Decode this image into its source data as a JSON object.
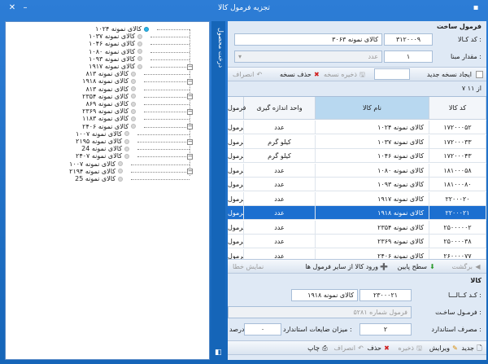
{
  "window": {
    "title": "تجزیه فرمول کالا"
  },
  "tree": {
    "root_label": "درخت محصول",
    "nodes": [
      {
        "label": "کالای نمونه ۱۰۲۴",
        "selected": true
      },
      {
        "label": "کالای نمونه ۱۰۳۷"
      },
      {
        "label": "کالای نمونه ۱۰۴۶"
      },
      {
        "label": "کالای نمونه ۱۰۸۰"
      },
      {
        "label": "کالای نمونه ۱۰۹۳"
      },
      {
        "label": "کالای نمونه ۱۹۱۷"
      },
      {
        "label": "کالای نمونه ۸۱۳"
      },
      {
        "label": "کالای نمونه ۱۹۱۸"
      },
      {
        "label": "کالای نمونه ۸۱۳"
      },
      {
        "label": "کالای نمونه ۲۳۵۴"
      },
      {
        "label": "کالای نمونه ۸۶۹"
      },
      {
        "label": "کالای نمونه ۲۳۶۹"
      },
      {
        "label": "کالای نمونه ۱۱۸۳"
      },
      {
        "label": "کالای نمونه ۲۴۰۶"
      },
      {
        "label": "کالای نمونه ۱۰۰۷"
      },
      {
        "label": "کالای نمونه ۲۱۹۵"
      },
      {
        "label": "کالای نمونه 24"
      },
      {
        "label": "کالای نمونه ۲۴۰۷"
      },
      {
        "label": "کالای نمونه ۱۰۰۷"
      },
      {
        "label": "کالای نمونه ۲۱۹۴"
      },
      {
        "label": "کالای نمونه 25"
      }
    ]
  },
  "formula": {
    "section_title": "فرمول ساخت",
    "code_label": "کد کـالا :",
    "code_value": "۳۱۲۰۰۰۹",
    "name_value": "کالای نمونه ۳۰۶۳",
    "qty_label": "مقدار مبنا :",
    "qty_value": "۱",
    "unit_value": "عدد",
    "new_copy_label": "ایجاد نسخه جدید",
    "save_copy": "ذخیره نسخه",
    "delete_copy": "حذف نسخه",
    "cancel": "انصراف",
    "record_count": "از ۱۱ ۷"
  },
  "grid": {
    "headers": [
      "کد کالا",
      "نام کالا",
      "واحد اندازه گیری",
      "فرمول"
    ],
    "rows": [
      [
        "۱۷۲۰۰۰۵۲",
        "کالای نمونه ۱۰۲۴",
        "عدد",
        "فرمول"
      ],
      [
        "۱۷۲۰۰۰۳۳",
        "کالای نمونه ۱۰۳۷",
        "کیلو گرم",
        "فرمول"
      ],
      [
        "۱۷۲۰۰۰۴۳",
        "کالای نمونه ۱۰۴۶",
        "کیلو گرم",
        "فرمول"
      ],
      [
        "۱۸۱۰۰۰۵۸",
        "کالای نمونه ۱۰۸۰",
        "عدد",
        "فرمول"
      ],
      [
        "۱۸۱۰۰۰۸۰",
        "کالای نمونه ۱۰۹۳",
        "عدد",
        "فرمول"
      ],
      [
        "۲۲۰۰۰۲۰",
        "کالای نمونه ۱۹۱۷",
        "عدد",
        "فرمول"
      ],
      [
        "۲۲۰۰۰۲۱",
        "کالای نمونه ۱۹۱۸",
        "عدد",
        "فرمول"
      ],
      [
        "۲۵۰۰۰۰۰۲",
        "کالای نمونه ۲۳۵۴",
        "عدد",
        "فرمول"
      ],
      [
        "۲۵۰۰۰۰۳۸",
        "کالای نمونه ۲۳۶۹",
        "عدد",
        "فرمول"
      ],
      [
        "۲۶۰۰۰۰۷۷",
        "کالای نمونه ۲۴۰۶",
        "عدد",
        "فرمول"
      ]
    ],
    "selected_row": 6
  },
  "nav_bar": {
    "back": "برگشت",
    "level_down": "سطح پایین",
    "import": "ورود کالا از سایر فرمول ها",
    "show_error": "نمایش خطا"
  },
  "item": {
    "section_title": "کالا",
    "code_label": "کـد کــالـــا :",
    "code_value": "۲۳۰۰۰۲۱",
    "name_value": "کالای نمونه ۱۹۱۸",
    "formula_label": "فرمـول ساخـت :",
    "formula_value": "فرمول شماره ۵۲۸۱",
    "consumption_label": "مصرف استاندارد :",
    "consumption_value": "۲",
    "waste_label": "میزان ضایعات استاندارد :",
    "waste_value": "۰",
    "percent_label": "درصد"
  },
  "bottom_bar": {
    "new": "جدید",
    "edit": "ویرایش",
    "save": "ذخیره",
    "delete": "حذف",
    "cancel": "انصراف",
    "print": "چاپ"
  },
  "colors": {
    "accent": "#1565b8",
    "selection": "#1c6fd0"
  }
}
